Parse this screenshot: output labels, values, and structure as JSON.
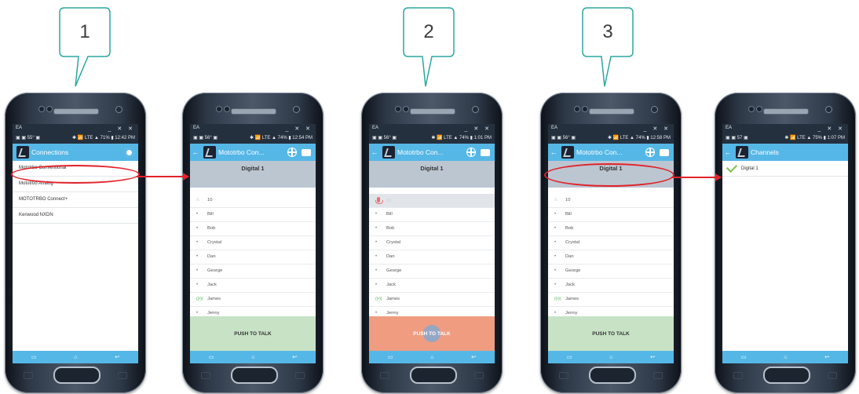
{
  "callouts": [
    "1",
    "2",
    "3"
  ],
  "status_bar": {
    "carrier": "EA",
    "window_controls": "_ ✕ ✕",
    "phone1": {
      "left": "▣ ▣ 55° ▣",
      "right": "✱ 📶 LTE ▲ 71% ▮ 12:42 PM"
    },
    "phone2": {
      "left": "▣ ▣ 56° ▣",
      "right": "✱ 📶 LTE ▲ 74% ▮ 12:54 PM"
    },
    "phone3": {
      "left": "▣ ▣ 56° ▣",
      "right": "✱ 📶 LTE ▲ 74% ▮ 1:01 PM"
    },
    "phone4": {
      "left": "▣ ▣ 56° ▣",
      "right": "✱ 📶 LTE ▲ 74% ▮ 12:58 PM"
    },
    "phone5": {
      "left": "▣ ▣ 57 ▣",
      "right": "✱ 📶 LTE ▲ 75% ▮ 1:07 PM"
    }
  },
  "connections_screen": {
    "title": "Connections",
    "items": [
      "Mototrbo Conventional",
      "Mototrbo Analog",
      "MOTOTRBO Connect+",
      "Kenwood NXDN"
    ]
  },
  "radio_screen": {
    "title": "Mototrbo Con...",
    "channel": "Digital 1",
    "members": [
      {
        "name": "10",
        "icon": "group-icon"
      },
      {
        "name": "Bill",
        "icon": "dot-icon"
      },
      {
        "name": "Bob",
        "icon": "dot-icon"
      },
      {
        "name": "Crystal",
        "icon": "dot-icon"
      },
      {
        "name": "Dan",
        "icon": "dot-icon"
      },
      {
        "name": "George",
        "icon": "dot-icon"
      },
      {
        "name": "Jack",
        "icon": "dot-icon"
      },
      {
        "name": "James",
        "icon": "radio-wave-icon"
      },
      {
        "name": "Jenny",
        "icon": "dot-icon"
      }
    ],
    "talking_value": "10",
    "ptt_label": "PUSH TO TALK"
  },
  "channels_screen": {
    "title": "Channels",
    "items": [
      "Digital 1"
    ]
  },
  "icons": {
    "nav_recent": "▭",
    "nav_home": "⌂",
    "nav_back": "↩",
    "group": "∴",
    "dot": "•",
    "radio": "((•))",
    "back_arrow": "←"
  },
  "colors": {
    "app_bar": "#55b7e6",
    "ptt_idle": "#c7e2c5",
    "ptt_active": "#ef9c81",
    "highlight": "#e2222a",
    "callout": "#2ba7a0"
  }
}
